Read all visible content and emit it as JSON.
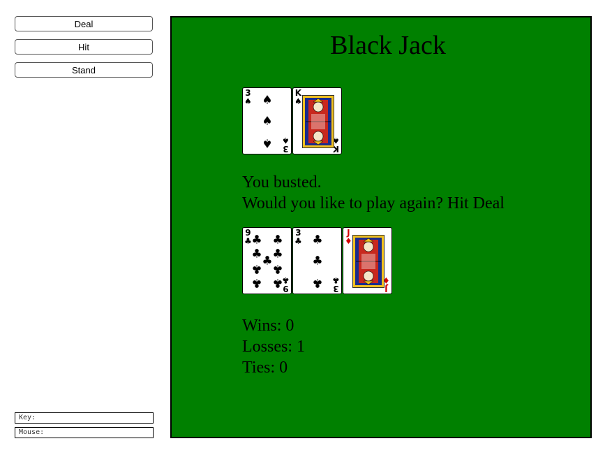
{
  "controls": {
    "deal_label": "Deal",
    "hit_label": "Hit",
    "stand_label": "Stand"
  },
  "status": {
    "key_label": "Key:",
    "mouse_label": "Mouse:"
  },
  "table": {
    "title": "Black Jack",
    "message_line1": "You busted.",
    "message_line2": "Would you like to play again?  Hit Deal",
    "dealer_hand": [
      {
        "rank": "3",
        "suit": "♠",
        "color": "black"
      },
      {
        "rank": "K",
        "suit": "♠",
        "color": "black"
      }
    ],
    "player_hand": [
      {
        "rank": "9",
        "suit": "♣",
        "color": "black"
      },
      {
        "rank": "3",
        "suit": "♣",
        "color": "black"
      },
      {
        "rank": "J",
        "suit": "♦",
        "color": "red"
      }
    ],
    "wins_text": "Wins: 0",
    "losses_text": "Losses: 1",
    "ties_text": "Ties: 0"
  },
  "colors": {
    "table_felt": "#008000",
    "card_red": "#d40000"
  }
}
